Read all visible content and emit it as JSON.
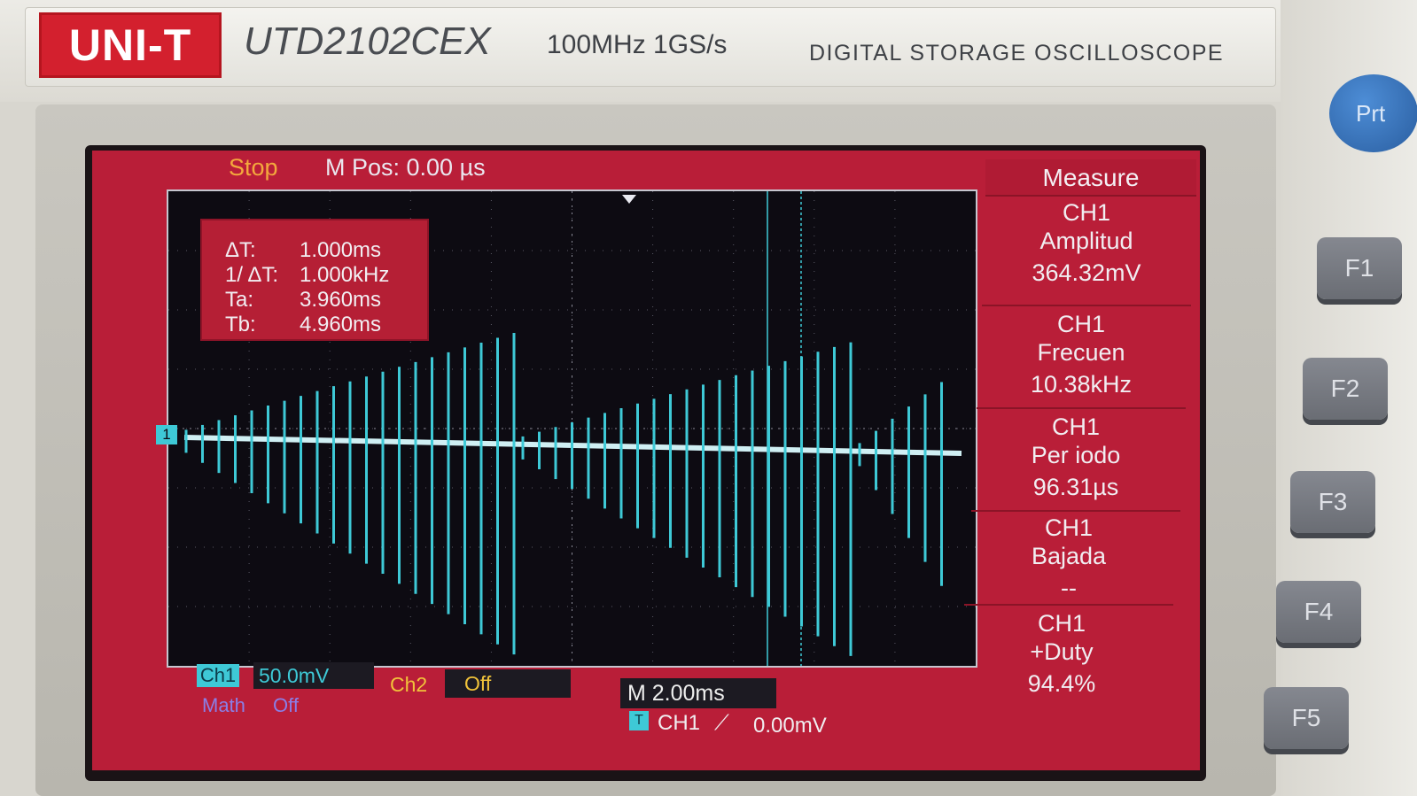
{
  "header": {
    "brand": "UNI-T",
    "model": "UTD2102CEX",
    "spec": "100MHz  1GS/s",
    "product": "DIGITAL STORAGE OSCILLOSCOPE"
  },
  "status": {
    "run_state": "Stop",
    "m_pos": "M Pos: 0.00 µs"
  },
  "cursor_readout": {
    "rows": [
      {
        "label": "ΔT:",
        "value": "1.000ms"
      },
      {
        "label": "1/ ΔT:",
        "value": "1.000kHz"
      },
      {
        "label": "Ta:",
        "value": "3.960ms"
      },
      {
        "label": "Tb:",
        "value": "4.960ms"
      }
    ]
  },
  "channel_marker": "1",
  "measure": {
    "title": "Measure",
    "items": [
      {
        "channel": "CH1",
        "name": "Amplitud",
        "value": "364.32mV"
      },
      {
        "channel": "CH1",
        "name": "Frecuen",
        "value": "10.38kHz"
      },
      {
        "channel": "CH1",
        "name": "Per iodo",
        "value": "96.31µs"
      },
      {
        "channel": "CH1",
        "name": "Bajada",
        "value": "--"
      },
      {
        "channel": "CH1",
        "name": "+Duty",
        "value": "94.4%"
      }
    ]
  },
  "bottom": {
    "ch1_label": "Ch1",
    "ch1_scale": "50.0mV",
    "ch2_label": "Ch2",
    "ch2_value": "Off",
    "math_label": "Math",
    "math_value": "Off",
    "timebase": "M 2.00ms",
    "trigger_icon": "T",
    "trigger_source": "CH1",
    "trigger_edge": "⟋",
    "trigger_level": "0.00mV"
  },
  "side_buttons": {
    "prt": "Prt",
    "f1": "F1",
    "f2": "F2",
    "f3": "F3",
    "f4": "F4",
    "f5": "F5"
  },
  "colors": {
    "screen_bg": "#b91e38",
    "trace": "#3ec9d6",
    "run_state": "#f3a83d",
    "ch2": "#f1c33a",
    "math": "#8a7fe6"
  }
}
